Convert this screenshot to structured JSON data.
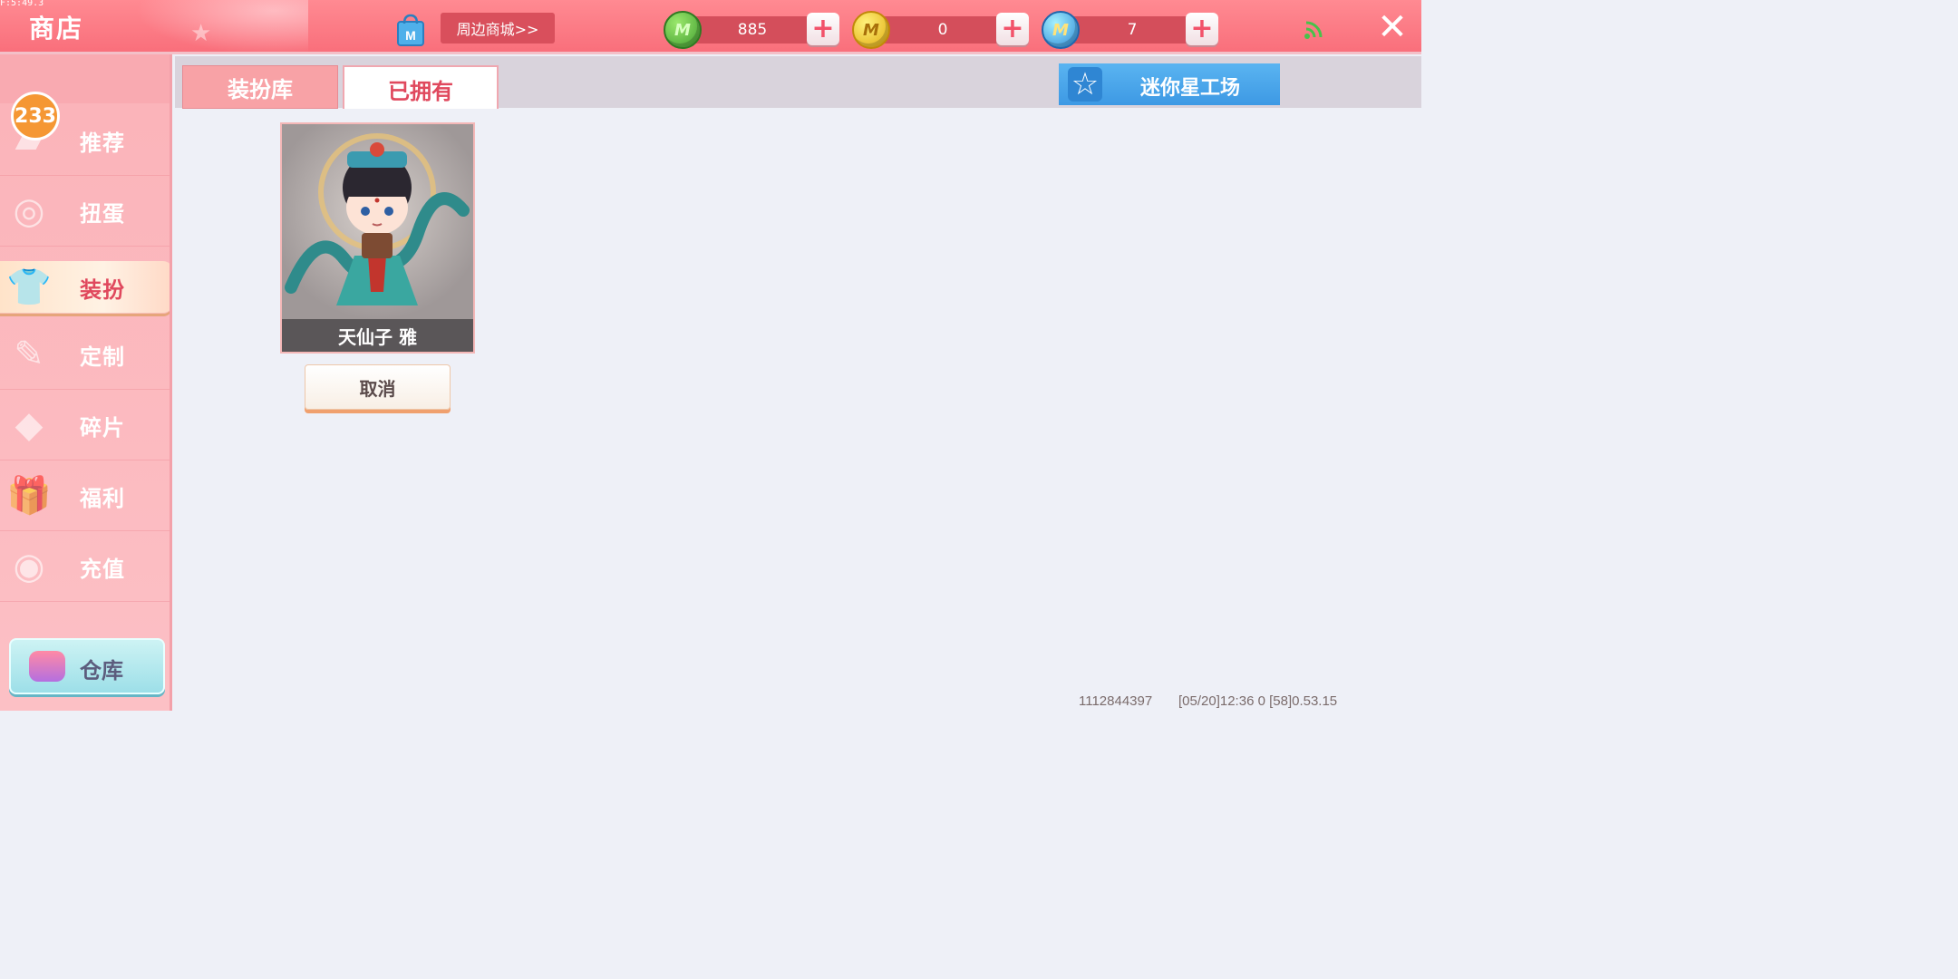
{
  "debug_overlay": {
    "fps": "F:5:49.3"
  },
  "header": {
    "title": "商店",
    "mall_link_label": "周边商城>>",
    "currencies": [
      {
        "icon": "green-mini-bean-icon",
        "value": "885"
      },
      {
        "icon": "gold-mini-coin-icon",
        "value": "0"
      },
      {
        "icon": "blue-mini-gem-icon",
        "value": "7"
      }
    ],
    "coin_letter": "M",
    "plus_symbol": "+",
    "close_symbol": "✕"
  },
  "sidebar": {
    "notification_badge": "233",
    "items": [
      {
        "label": "推荐",
        "icon": "recommend-icon"
      },
      {
        "label": "扭蛋",
        "icon": "gacha-icon"
      },
      {
        "label": "装扮",
        "icon": "outfit-shirt-icon",
        "active": true
      },
      {
        "label": "定制",
        "icon": "customize-pencil-icon"
      },
      {
        "label": "碎片",
        "icon": "fragment-icon"
      },
      {
        "label": "福利",
        "icon": "gift-icon"
      },
      {
        "label": "充值",
        "icon": "recharge-coins-icon"
      }
    ],
    "warehouse_label": "仓库"
  },
  "tabs": [
    {
      "label": "装扮库",
      "active": false
    },
    {
      "label": "已拥有",
      "active": true
    }
  ],
  "workshop_button": {
    "label": "迷你星工场",
    "icon": "star-icon"
  },
  "owned_items": [
    {
      "name": "天仙子 雅",
      "action_label": "取消"
    }
  ],
  "footer_debug": {
    "uid": "1112844397",
    "info": "[05/20]12:36 0 [58]0.53.15"
  },
  "colors": {
    "accent_pink": "#f96f7b",
    "active_tab_text": "#e0485d",
    "workshop_blue": "#3d99e4",
    "content_bg": "#eef0f7"
  }
}
